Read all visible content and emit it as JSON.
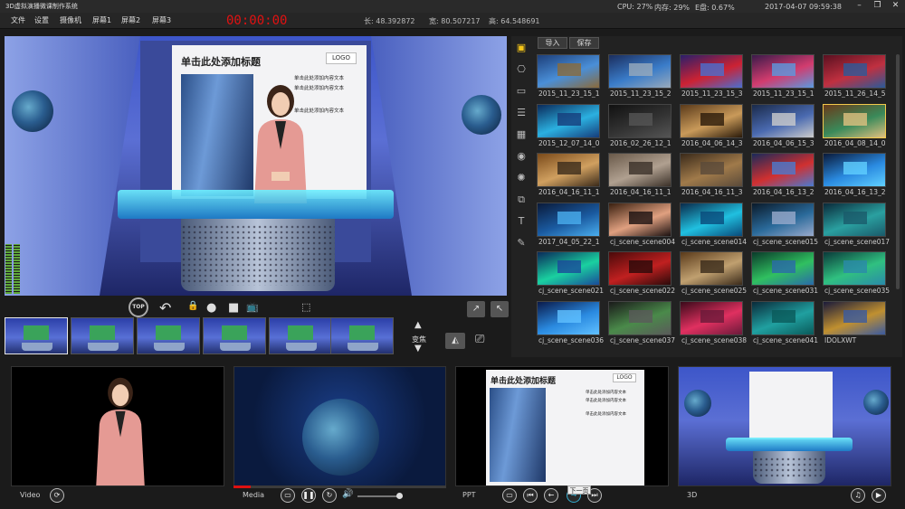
{
  "app": {
    "title": "3D虚拟演播微课制作系统"
  },
  "menu": [
    "文件",
    "设置",
    "摄像机",
    "屏幕1",
    "屏幕2",
    "屏幕3"
  ],
  "timer": "00:00:00",
  "camera_readout": {
    "length": "长: 48.392872",
    "width": "宽: 80.507217",
    "height": "高: 64.548691"
  },
  "system": {
    "cpu": "CPU: 27%",
    "memory": "内存: 29%",
    "disk": "E盘: 0.67%",
    "datetime": "2017-04-07  09:59:38"
  },
  "preview": {
    "slide_title": "单击此处添加标题",
    "slide_logo": "LOGO",
    "slide_lines": [
      "单击此处添加内容文本",
      "单击此处添加内容文本",
      "单击此处添加内容文本"
    ]
  },
  "toolbar": {
    "top_label": "TOP",
    "transition_label": "变焦"
  },
  "scene_panel": {
    "import_label": "导入",
    "save_label": "保存",
    "scenes": [
      {
        "label": "2015_11_23_15_1",
        "colors": [
          "#1d3f7a",
          "#4a8fd8",
          "#8a6a3a"
        ]
      },
      {
        "label": "2015_11_23_15_2",
        "colors": [
          "#1b2e5e",
          "#3a7cc9",
          "#9ab"
        ]
      },
      {
        "label": "2015_11_23_15_3",
        "colors": [
          "#2a1f6b",
          "#c23",
          "#4a6fd0"
        ]
      },
      {
        "label": "2015_11_23_15_1",
        "colors": [
          "#3a1a4a",
          "#d23c6e",
          "#5a9ae0"
        ]
      },
      {
        "label": "2015_11_26_14_5",
        "colors": [
          "#5a1020",
          "#c03040",
          "#2a5a9a"
        ]
      },
      {
        "label": "2015_12_07_14_0",
        "colors": [
          "#0a2a5a",
          "#2bb0e0",
          "#163c7a"
        ]
      },
      {
        "label": "2016_02_26_12_1",
        "colors": [
          "#111",
          "#333",
          "#555"
        ]
      },
      {
        "label": "2016_04_06_14_3",
        "colors": [
          "#5a3a1a",
          "#c99a5a",
          "#2a1a0a"
        ]
      },
      {
        "label": "2016_04_06_15_3",
        "colors": [
          "#1a2a4a",
          "#4a6ab0",
          "#ccc"
        ]
      },
      {
        "label": "2016_04_08_14_0",
        "colors": [
          "#6a3a1a",
          "#3a8a5a",
          "#e0c080"
        ]
      },
      {
        "label": "2016_04_16_11_1",
        "colors": [
          "#7a4a1a",
          "#d0a060",
          "#3a2a1a"
        ]
      },
      {
        "label": "2016_04_16_11_1",
        "colors": [
          "#6a5a4a",
          "#b0a090",
          "#3a3028"
        ]
      },
      {
        "label": "2016_04_16_11_3",
        "colors": [
          "#3a2a1a",
          "#a07a4a",
          "#5a4a3a"
        ]
      },
      {
        "label": "2016_04_16_13_2",
        "colors": [
          "#1a2a5a",
          "#d03030",
          "#4a7ad0"
        ]
      },
      {
        "label": "2016_04_16_13_2",
        "colors": [
          "#0a1a3a",
          "#2a8ae0",
          "#60d0ff"
        ]
      },
      {
        "label": "2017_04_05_22_1",
        "colors": [
          "#0a1a3a",
          "#1a5aa0",
          "#4aaeee"
        ]
      },
      {
        "label": "cj_scene_scene004",
        "colors": [
          "#3a2010",
          "#e0a080",
          "#1a1010"
        ]
      },
      {
        "label": "cj_scene_scene014",
        "colors": [
          "#0a2a4a",
          "#20c0e0",
          "#0a4a7a"
        ]
      },
      {
        "label": "cj_scene_scene015",
        "colors": [
          "#0a1a2a",
          "#2a6a9a",
          "#9ac"
        ]
      },
      {
        "label": "cj_scene_scene017",
        "colors": [
          "#0a2a3a",
          "#2aa0a0",
          "#1a5a6a"
        ]
      },
      {
        "label": "cj_scene_scene021",
        "colors": [
          "#0a2a5a",
          "#1ad0a0",
          "#1a4a9a"
        ]
      },
      {
        "label": "cj_scene_scene022",
        "colors": [
          "#4a0a0a",
          "#c02020",
          "#2a0a0a"
        ]
      },
      {
        "label": "cj_scene_scene025",
        "colors": [
          "#5a3a1a",
          "#c0a070",
          "#3a2a1a"
        ]
      },
      {
        "label": "cj_scene_scene031",
        "colors": [
          "#0a3a2a",
          "#30c060",
          "#2a6aaa"
        ]
      },
      {
        "label": "cj_scene_scene035",
        "colors": [
          "#0a3a3a",
          "#30c080",
          "#2a8aaa"
        ]
      },
      {
        "label": "cj_scene_scene036",
        "colors": [
          "#0a1a4a",
          "#2a8ae0",
          "#60c0ff"
        ]
      },
      {
        "label": "cj_scene_scene037",
        "colors": [
          "#1a1a1a",
          "#4a8a4a",
          "#5a5a5a"
        ]
      },
      {
        "label": "cj_scene_scene038",
        "colors": [
          "#3a0a1a",
          "#e03060",
          "#6a1a3a"
        ]
      },
      {
        "label": "cj_scene_scene041",
        "colors": [
          "#0a2a3a",
          "#20a0a0",
          "#0a5a5a"
        ]
      },
      {
        "label": "IDOLXWT",
        "colors": [
          "#1a1a3a",
          "#c09030",
          "#3a5aa0"
        ]
      }
    ]
  },
  "monitors": {
    "video_label": "Video",
    "media_label": "Media",
    "ppt_label": "PPT",
    "threed_label": "3D",
    "ppt_slide_title": "单击此处添加标题",
    "ppt_slide_logo": "LOGO",
    "ppt_slide_lines": [
      "单击此处添加内容文本",
      "单击此处添加内容文本",
      "单击此处添加内容文本"
    ],
    "media_progress": 0.08,
    "volume": 0.85,
    "tooltip": "下一页"
  },
  "colors": {
    "timer": "#e11111",
    "selected_border": "#f2c94c",
    "accent": "#5fa83a"
  }
}
